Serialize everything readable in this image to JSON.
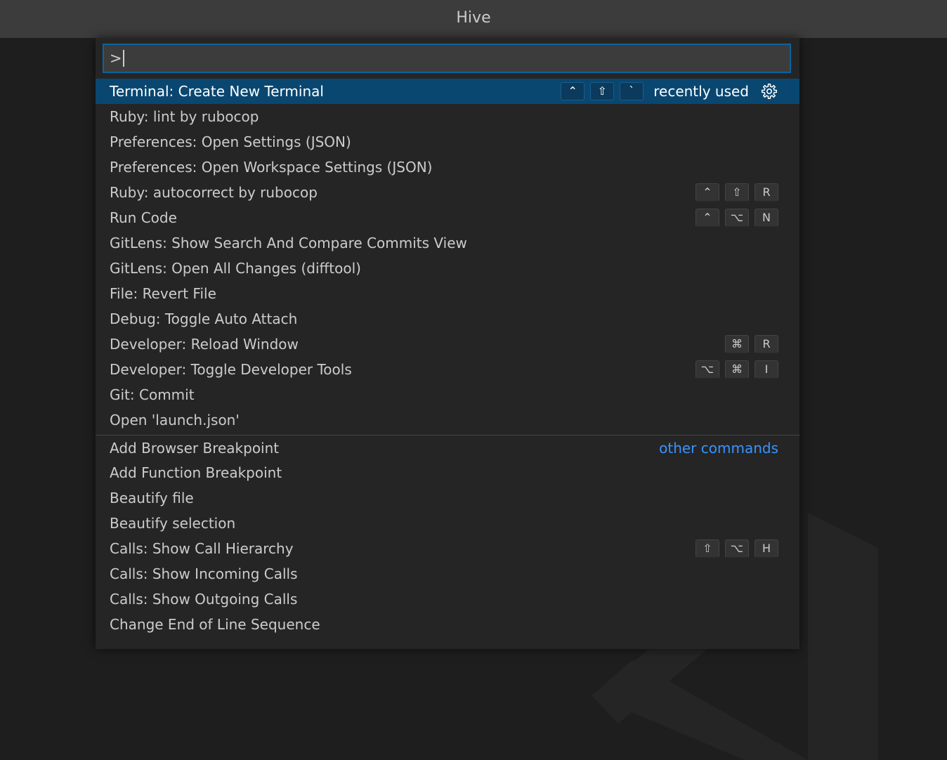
{
  "window": {
    "title": "Hive"
  },
  "palette": {
    "input_value": ">",
    "recent": [
      {
        "label": "Terminal: Create New Terminal",
        "keys": [
          "⌃",
          "⇧",
          "`"
        ],
        "selected": true,
        "hint": "recently used"
      },
      {
        "label": "Ruby: lint by rubocop",
        "keys": []
      },
      {
        "label": "Preferences: Open Settings (JSON)",
        "keys": []
      },
      {
        "label": "Preferences: Open Workspace Settings (JSON)",
        "keys": []
      },
      {
        "label": "Ruby: autocorrect by rubocop",
        "keys": [
          "⌃",
          "⇧",
          "R"
        ]
      },
      {
        "label": "Run Code",
        "keys": [
          "⌃",
          "⌥",
          "N"
        ]
      },
      {
        "label": "GitLens: Show Search And Compare Commits View",
        "keys": []
      },
      {
        "label": "GitLens: Open All Changes (difftool)",
        "keys": []
      },
      {
        "label": "File: Revert File",
        "keys": []
      },
      {
        "label": "Debug: Toggle Auto Attach",
        "keys": []
      },
      {
        "label": "Developer: Reload Window",
        "keys": [
          "⌘",
          "R"
        ]
      },
      {
        "label": "Developer: Toggle Developer Tools",
        "keys": [
          "⌥",
          "⌘",
          "I"
        ]
      },
      {
        "label": "Git: Commit",
        "keys": []
      },
      {
        "label": "Open 'launch.json'",
        "keys": []
      }
    ],
    "other_label": "other commands",
    "other": [
      {
        "label": "Add Browser Breakpoint",
        "keys": []
      },
      {
        "label": "Add Function Breakpoint",
        "keys": []
      },
      {
        "label": "Beautify file",
        "keys": []
      },
      {
        "label": "Beautify selection",
        "keys": []
      },
      {
        "label": "Calls: Show Call Hierarchy",
        "keys": [
          "⇧",
          "⌥",
          "H"
        ]
      },
      {
        "label": "Calls: Show Incoming Calls",
        "keys": []
      },
      {
        "label": "Calls: Show Outgoing Calls",
        "keys": []
      },
      {
        "label": "Change End of Line Sequence",
        "keys": []
      }
    ],
    "gear_icon": "gear-icon"
  },
  "colors": {
    "selection": "#094771",
    "focus_border": "#0e639c",
    "link": "#3794ff"
  }
}
